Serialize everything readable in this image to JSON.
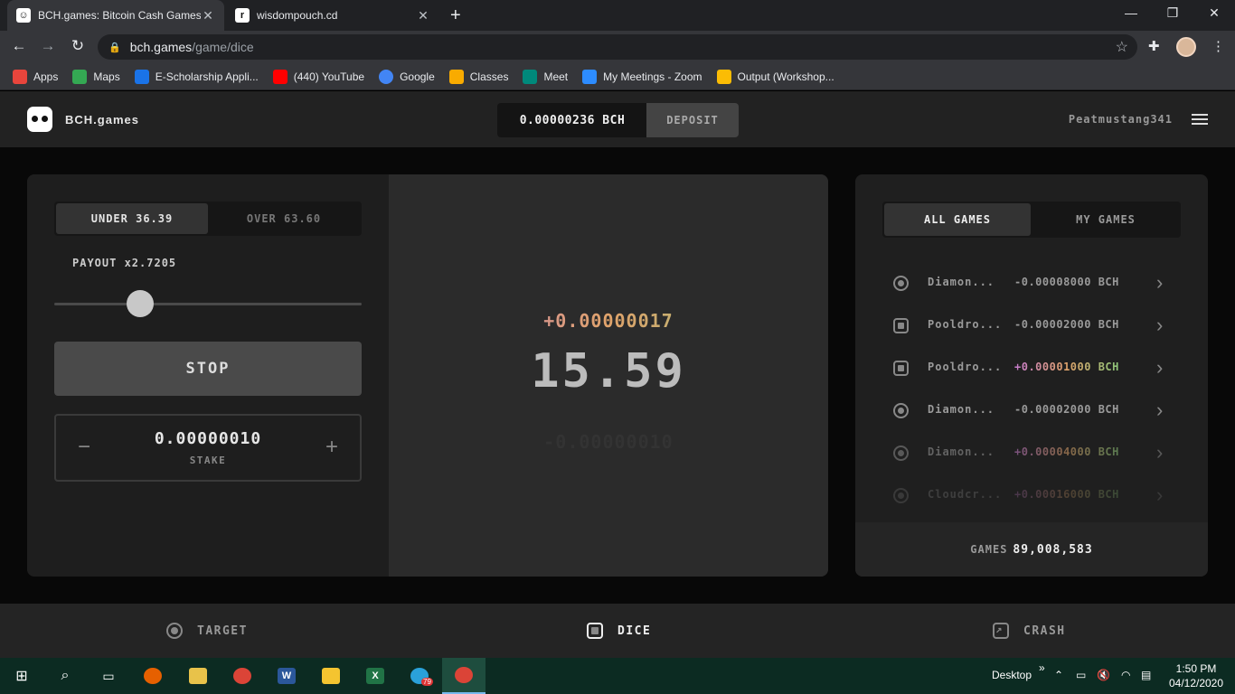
{
  "browser": {
    "tabs": [
      {
        "title": "BCH.games: Bitcoin Cash Games",
        "active": true
      },
      {
        "title": "wisdompouch.cd",
        "active": false
      }
    ],
    "url_host": "bch.games",
    "url_path": "/game/dice",
    "bookmarks": [
      {
        "label": "Apps",
        "icon": "apps-grid-icon",
        "color": "#e8453c"
      },
      {
        "label": "Maps",
        "icon": "maps-icon",
        "color": "#34a853"
      },
      {
        "label": "E-Scholarship Appli...",
        "icon": "scholarship-icon",
        "color": "#1a73e8"
      },
      {
        "label": "(440) YouTube",
        "icon": "youtube-icon",
        "color": "#ff0000"
      },
      {
        "label": "Google",
        "icon": "google-icon",
        "color": "#4285f4"
      },
      {
        "label": "Classes",
        "icon": "classroom-icon",
        "color": "#f9ab00"
      },
      {
        "label": "Meet",
        "icon": "meet-icon",
        "color": "#00897b"
      },
      {
        "label": "My Meetings - Zoom",
        "icon": "zoom-icon",
        "color": "#2d8cff"
      },
      {
        "label": "Output (Workshop...",
        "icon": "drive-icon",
        "color": "#fbbc04"
      }
    ]
  },
  "header": {
    "brand": "BCH.games",
    "balance": "0.00000236 BCH",
    "deposit_label": "DEPOSIT",
    "username": "Peatmustang341"
  },
  "dice": {
    "under_label": "UNDER 36.39",
    "over_label": "OVER 63.60",
    "payout_label": "PAYOUT x2.7205",
    "slider_value": 0.2794,
    "stop_label": "STOP",
    "stake_value": "0.00000010",
    "stake_label": "STAKE",
    "stake_minus": "−",
    "stake_plus": "+",
    "win_amount": "+0.00000017",
    "roll_result": "15.59",
    "loss_amount": "-0.00000010"
  },
  "history": {
    "all_games_label": "ALL GAMES",
    "my_games_label": "MY GAMES",
    "rows": [
      {
        "game": "Diamon...",
        "amount": "-0.00008000 BCH",
        "icon": "target",
        "win": false,
        "opacity": 1
      },
      {
        "game": "Pooldro...",
        "amount": "-0.00002000 BCH",
        "icon": "dice",
        "win": false,
        "opacity": 1
      },
      {
        "game": "Pooldro...",
        "amount": "+0.00001000 BCH",
        "icon": "dice",
        "win": true,
        "opacity": 1
      },
      {
        "game": "Diamon...",
        "amount": "-0.00002000 BCH",
        "icon": "target",
        "win": false,
        "opacity": 1
      },
      {
        "game": "Diamon...",
        "amount": "+0.00004000 BCH",
        "icon": "target",
        "win": true,
        "opacity": 0.55
      },
      {
        "game": "Cloudcr...",
        "amount": "+0.00016000 BCH",
        "icon": "target",
        "win": true,
        "opacity": 0.25
      }
    ],
    "games_label": "GAMES",
    "games_count": "89,008,583"
  },
  "game_nav": {
    "target_label": "TARGET",
    "dice_label": "DICE",
    "crash_label": "CRASH"
  },
  "taskbar": {
    "desktop_label": "Desktop",
    "time": "1:50 PM",
    "date": "04/12/2020",
    "telegram_badge": "79"
  }
}
